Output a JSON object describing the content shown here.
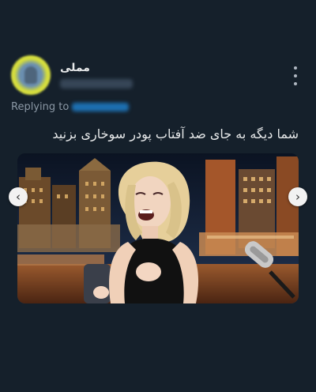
{
  "tweet": {
    "display_name": "مملی",
    "replying_label": "Replying to",
    "text": "شما دیگه به جای ضد آفتاب پودر سوخاری بزنید"
  },
  "media": {
    "nav_prev_icon": "chevron-left-icon",
    "nav_next_icon": "chevron-right-icon",
    "nav_prev_glyph": "‹",
    "nav_next_glyph": "›"
  },
  "colors": {
    "background": "#15202b",
    "text": "#e7e9ea",
    "muted": "#8b98a5",
    "link": "#1d9bf0"
  }
}
